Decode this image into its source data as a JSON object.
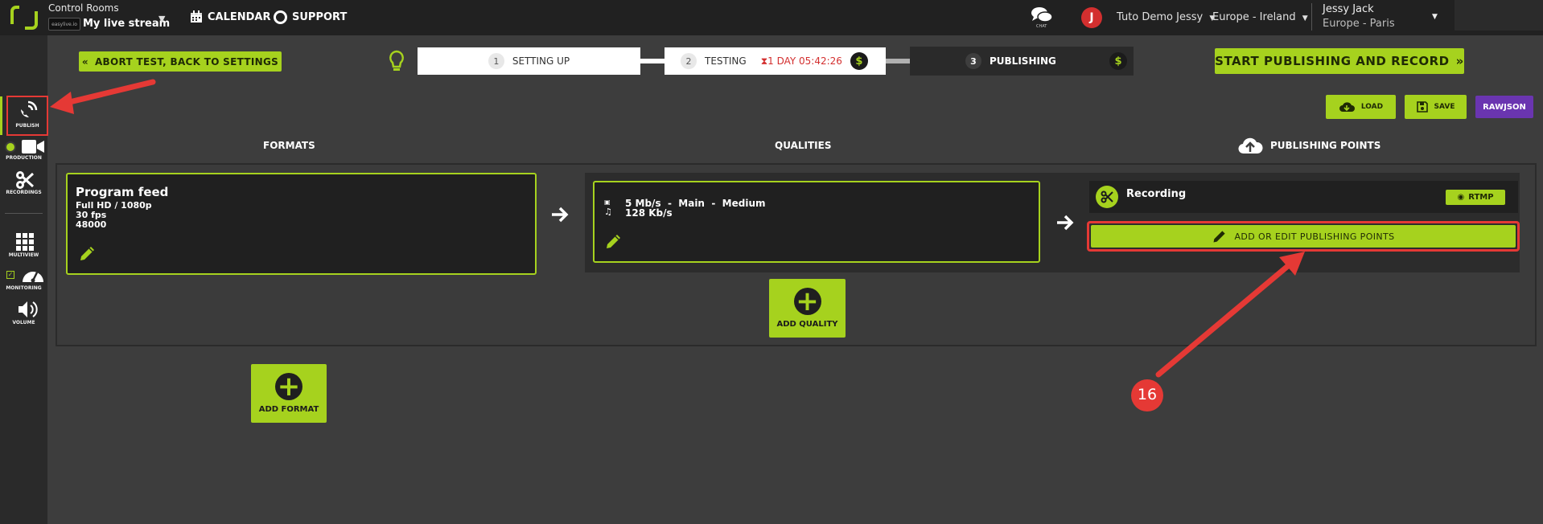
{
  "topbar": {
    "title": "Control Rooms",
    "badge": "easylive.io",
    "stream": "My live stream",
    "calendar": "CALENDAR",
    "support": "SUPPORT",
    "chat": "CHAT",
    "avatar_letter": "J",
    "org": "Tuto Demo Jessy",
    "region": "Europe - Ireland",
    "user_name": "Jessy Jack",
    "user_tz": "Europe - Paris"
  },
  "sidebar": {
    "publish": "PUBLISH",
    "production": "PRODUCTION",
    "recordings": "RECORDINGS",
    "multiview": "MULTIVIEW",
    "monitoring": "MONITORING",
    "volume": "VOLUME"
  },
  "steps": {
    "abort": "ABORT TEST, BACK TO SETTINGS",
    "s1_num": "1",
    "s1": "SETTING UP",
    "s2_num": "2",
    "s2": "TESTING",
    "timer": "1 DAY 05:42:26",
    "s3_num": "3",
    "s3": "PUBLISHING",
    "dollar": "$",
    "start": "START PUBLISHING AND RECORD"
  },
  "actions": {
    "load": "LOAD",
    "save": "SAVE",
    "rawjson": "RAWJSON"
  },
  "columns": {
    "formats": "FORMATS",
    "qualities": "QUALITIES",
    "publishing_points": "PUBLISHING POINTS"
  },
  "format_card": {
    "title": "Program feed",
    "res": "Full HD / 1080p",
    "fps": "30 fps",
    "rate": "48000"
  },
  "quality_card": {
    "video": "5 Mb/s  -  Main  -  Medium",
    "audio": "128 Kb/s"
  },
  "publishing": {
    "recording": "Recording",
    "rtmp": "RTMP",
    "edit": "ADD OR EDIT PUBLISHING POINTS"
  },
  "tiles": {
    "add_quality": "ADD QUALITY",
    "add_format": "ADD FORMAT"
  },
  "annotation": {
    "number": "16"
  },
  "colors": {
    "accent": "#a6d21e",
    "annotation": "#e53935",
    "purple": "#6a35b0"
  }
}
